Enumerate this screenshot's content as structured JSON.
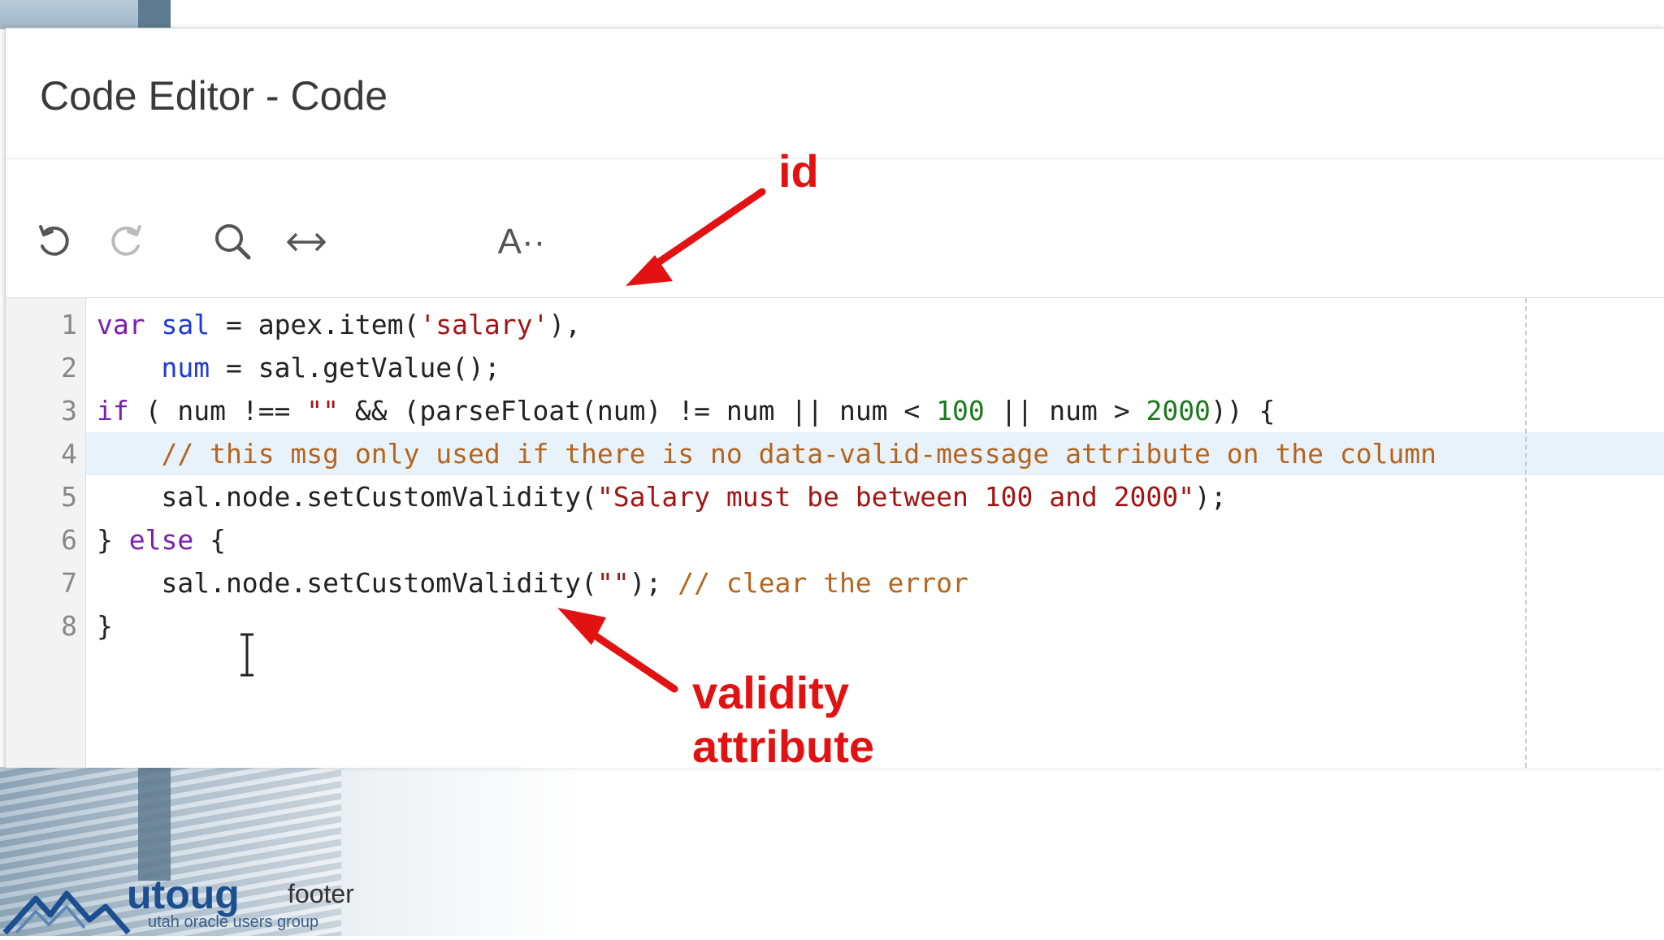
{
  "dialog": {
    "title": "Code Editor - Code"
  },
  "toolbar": {
    "buttons": [
      {
        "name": "undo",
        "icon": "undo-icon"
      },
      {
        "name": "redo",
        "icon": "redo-icon"
      },
      {
        "name": "search",
        "icon": "search-icon"
      },
      {
        "name": "expand",
        "icon": "arrows-horizontal-icon"
      },
      {
        "name": "font-settings",
        "icon": "font-size-icon",
        "label": "A··"
      }
    ]
  },
  "editor": {
    "active_line": 4,
    "line_numbers": [
      "1",
      "2",
      "3",
      "4",
      "5",
      "6",
      "7",
      "8"
    ],
    "lines": [
      [
        {
          "t": "kw",
          "v": "var"
        },
        {
          "t": "p",
          "v": " "
        },
        {
          "t": "var",
          "v": "sal"
        },
        {
          "t": "p",
          "v": " = apex.item("
        },
        {
          "t": "str",
          "v": "'salary'"
        },
        {
          "t": "p",
          "v": "),"
        }
      ],
      [
        {
          "t": "p",
          "v": "    "
        },
        {
          "t": "var",
          "v": "num"
        },
        {
          "t": "p",
          "v": " = sal.getValue();"
        }
      ],
      [
        {
          "t": "kw",
          "v": "if"
        },
        {
          "t": "p",
          "v": " ( num !== "
        },
        {
          "t": "str",
          "v": "\"\""
        },
        {
          "t": "p",
          "v": " && (parseFloat(num) != num || num < "
        },
        {
          "t": "num",
          "v": "100"
        },
        {
          "t": "p",
          "v": " || num > "
        },
        {
          "t": "num",
          "v": "2000"
        },
        {
          "t": "p",
          "v": ")) {"
        }
      ],
      [
        {
          "t": "p",
          "v": "    "
        },
        {
          "t": "cmt",
          "v": "// this msg only used if there is no data-valid-message attribute on the column"
        }
      ],
      [
        {
          "t": "p",
          "v": "    sal.node.setCustomValidity("
        },
        {
          "t": "str",
          "v": "\"Salary must be between 100 and 2000\""
        },
        {
          "t": "p",
          "v": ");"
        }
      ],
      [
        {
          "t": "p",
          "v": "} "
        },
        {
          "t": "kw",
          "v": "else"
        },
        {
          "t": "p",
          "v": " {"
        }
      ],
      [
        {
          "t": "p",
          "v": "    sal.node.setCustomValidity("
        },
        {
          "t": "str",
          "v": "\"\""
        },
        {
          "t": "p",
          "v": "); "
        },
        {
          "t": "cmt",
          "v": "// clear the error"
        }
      ],
      [
        {
          "t": "p",
          "v": "}"
        }
      ]
    ]
  },
  "annotations": {
    "id_label": "id",
    "validity_line1": "validity",
    "validity_line2": "attribute",
    "color": "#e31212"
  },
  "footer": {
    "logo_word": "utoug",
    "logo_tagline": "utah oracle users group",
    "label": "footer"
  },
  "colors": {
    "keyword": "#7a1fb0",
    "variable": "#1f3bd6",
    "string": "#a31515",
    "number": "#1b7a1b",
    "comment": "#b5651d",
    "active_line_bg": "#e8f2fb"
  }
}
